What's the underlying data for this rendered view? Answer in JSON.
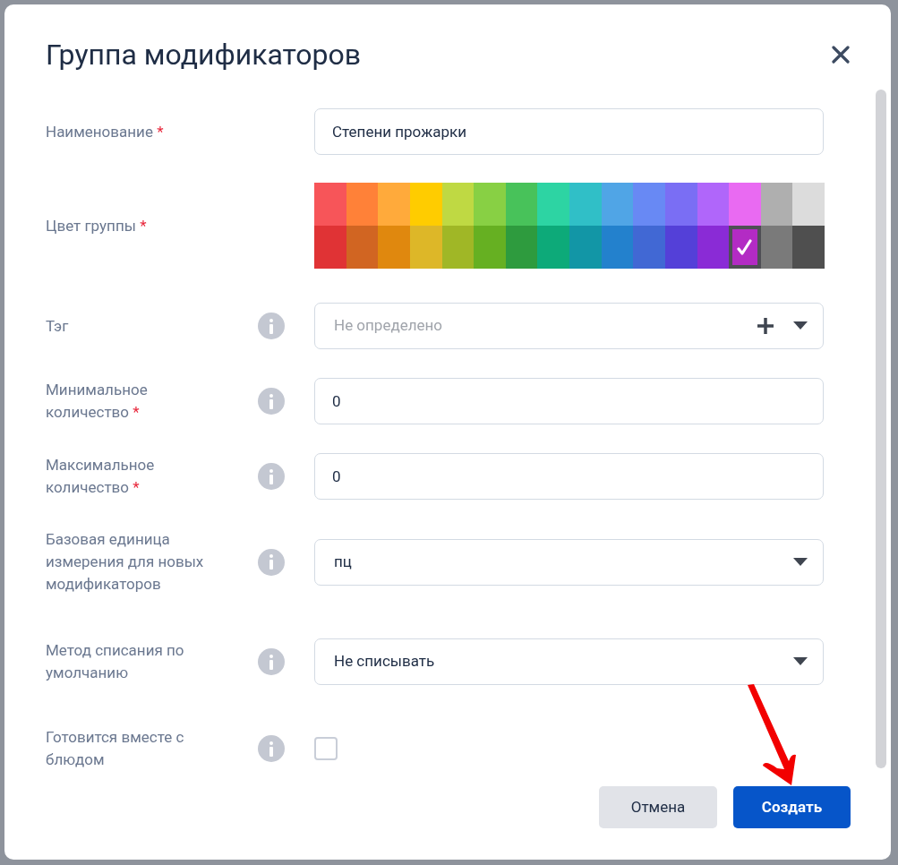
{
  "dialog": {
    "title": "Группа модификаторов",
    "fields": [
      {
        "kind": "text",
        "label": "Наименование",
        "required_mark": "*",
        "info": false,
        "value": "Степени прожарки"
      },
      {
        "kind": "palette",
        "label": "Цвет группы",
        "required_mark": "*",
        "info": false,
        "colors": [
          {
            "color": "#f75559",
            "selected": false
          },
          {
            "color": "#ff8138",
            "selected": false
          },
          {
            "color": "#ffaa3b",
            "selected": false
          },
          {
            "color": "#ffcc00",
            "selected": false
          },
          {
            "color": "#bfd943",
            "selected": false
          },
          {
            "color": "#88d044",
            "selected": false
          },
          {
            "color": "#48c25a",
            "selected": false
          },
          {
            "color": "#2dd4a3",
            "selected": false
          },
          {
            "color": "#30bfc7",
            "selected": false
          },
          {
            "color": "#50a5e6",
            "selected": false
          },
          {
            "color": "#6889f4",
            "selected": false
          },
          {
            "color": "#7a6ef4",
            "selected": false
          },
          {
            "color": "#b066fa",
            "selected": false
          },
          {
            "color": "#e96af2",
            "selected": false
          },
          {
            "color": "#afafaf",
            "selected": false
          },
          {
            "color": "#dcdcdc",
            "selected": false
          },
          {
            "color": "#e03335",
            "selected": false
          },
          {
            "color": "#d16522",
            "selected": false
          },
          {
            "color": "#e0880e",
            "selected": false
          },
          {
            "color": "#ddb728",
            "selected": false
          },
          {
            "color": "#a0b726",
            "selected": false
          },
          {
            "color": "#66b022",
            "selected": false
          },
          {
            "color": "#2e9b3e",
            "selected": false
          },
          {
            "color": "#0daa79",
            "selected": false
          },
          {
            "color": "#1296a6",
            "selected": false
          },
          {
            "color": "#2381cd",
            "selected": false
          },
          {
            "color": "#4168d4",
            "selected": false
          },
          {
            "color": "#5440d8",
            "selected": false
          },
          {
            "color": "#8a2bd6",
            "selected": false
          },
          {
            "color": "#b32bc4",
            "selected": true
          },
          {
            "color": "#7a7a7a",
            "selected": false
          },
          {
            "color": "#4f4f4f",
            "selected": false
          }
        ]
      },
      {
        "kind": "select",
        "label": "Тэг",
        "info": true,
        "placeholder": "Не определено",
        "add_button": true
      },
      {
        "kind": "text",
        "label": "Минимальное количество",
        "required_mark": "*",
        "info": true,
        "value": "0"
      },
      {
        "kind": "text",
        "label": "Максимальное количество",
        "required_mark": "*",
        "info": true,
        "value": "0"
      },
      {
        "kind": "select",
        "label": "Базовая единица измерения для новых модификаторов",
        "info": true,
        "value": "пц",
        "add_button": false
      },
      {
        "kind": "select",
        "label": "Метод списания по умолчанию",
        "info": true,
        "value": "Не списывать",
        "add_button": false
      },
      {
        "kind": "checkbox",
        "label": "Готовится вместе с блюдом",
        "info": true,
        "checked": false
      }
    ],
    "buttons": [
      {
        "kind": "secondary",
        "label": "Отмена"
      },
      {
        "kind": "primary",
        "label": "Создать"
      }
    ]
  }
}
